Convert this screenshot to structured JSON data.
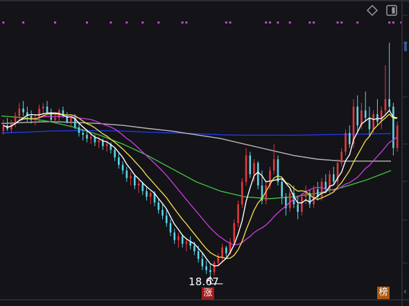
{
  "toolbar": {
    "diamond_icon": "diamond-outline-icon",
    "panel_icon": "panel-toggle-icon"
  },
  "annotations": {
    "low_price_label": "18.67",
    "zhang_badge": "涨",
    "bang_badge": "榜"
  },
  "colors": {
    "background": "#131318",
    "up": "#e8373d",
    "down": "#5fd3e6",
    "ma5": "#ffffff",
    "ma10": "#f0d84a",
    "ma20": "#c63bd8",
    "ma60": "#3fbf3f",
    "ma120": "#b9b9b9",
    "ma250": "#2238e6",
    "signal_dots": "#c24ad1"
  },
  "chart_data": {
    "type": "candlestick",
    "title": "",
    "ylim": [
      18.3,
      25.3
    ],
    "signal_dot_indices": [
      0,
      5,
      13,
      21,
      27,
      31,
      35,
      39,
      45,
      46,
      56,
      57,
      66,
      67,
      69,
      72,
      77,
      78,
      84,
      85,
      89,
      97,
      98,
      100
    ],
    "candles": [
      [
        22.55,
        22.85,
        22.45,
        22.7
      ],
      [
        22.7,
        22.9,
        22.55,
        22.6
      ],
      [
        22.6,
        22.85,
        22.5,
        22.75
      ],
      [
        22.75,
        23.05,
        22.65,
        22.95
      ],
      [
        22.95,
        23.3,
        22.85,
        23.15
      ],
      [
        23.15,
        23.35,
        22.95,
        23.05
      ],
      [
        23.05,
        23.2,
        22.8,
        22.95
      ],
      [
        22.95,
        23.1,
        22.75,
        22.85
      ],
      [
        22.85,
        23.0,
        22.7,
        22.9
      ],
      [
        22.9,
        23.25,
        22.8,
        23.15
      ],
      [
        23.15,
        23.3,
        23.0,
        23.2
      ],
      [
        23.2,
        23.35,
        23.0,
        23.05
      ],
      [
        23.05,
        23.15,
        22.8,
        22.85
      ],
      [
        22.85,
        23.0,
        22.75,
        22.9
      ],
      [
        22.9,
        23.15,
        22.8,
        23.1
      ],
      [
        23.1,
        23.2,
        22.9,
        22.95
      ],
      [
        22.95,
        23.05,
        22.75,
        22.8
      ],
      [
        22.8,
        22.95,
        22.65,
        22.9
      ],
      [
        22.9,
        23.0,
        22.6,
        22.65
      ],
      [
        22.65,
        22.75,
        22.4,
        22.5
      ],
      [
        22.5,
        22.6,
        22.3,
        22.45
      ],
      [
        22.45,
        22.55,
        22.25,
        22.35
      ],
      [
        22.35,
        22.5,
        22.2,
        22.4
      ],
      [
        22.4,
        22.45,
        22.15,
        22.25
      ],
      [
        22.25,
        22.4,
        22.1,
        22.3
      ],
      [
        22.3,
        22.35,
        22.05,
        22.15
      ],
      [
        22.15,
        22.3,
        22.0,
        22.2
      ],
      [
        22.2,
        22.25,
        21.95,
        22.05
      ],
      [
        22.05,
        22.1,
        21.75,
        21.85
      ],
      [
        21.85,
        21.95,
        21.55,
        21.65
      ],
      [
        21.65,
        21.75,
        21.4,
        21.5
      ],
      [
        21.5,
        21.6,
        21.2,
        21.3
      ],
      [
        21.3,
        21.45,
        21.1,
        21.35
      ],
      [
        21.35,
        21.4,
        21.0,
        21.1
      ],
      [
        21.1,
        21.25,
        20.9,
        21.15
      ],
      [
        21.15,
        21.2,
        20.85,
        20.95
      ],
      [
        20.95,
        21.05,
        20.7,
        20.8
      ],
      [
        20.8,
        20.95,
        20.6,
        20.9
      ],
      [
        20.9,
        20.95,
        20.55,
        20.65
      ],
      [
        20.65,
        20.75,
        20.35,
        20.45
      ],
      [
        20.45,
        20.6,
        20.2,
        20.3
      ],
      [
        20.3,
        20.45,
        20.0,
        20.1
      ],
      [
        20.1,
        20.2,
        19.75,
        19.85
      ],
      [
        19.85,
        19.95,
        19.55,
        19.65
      ],
      [
        19.65,
        19.85,
        19.45,
        19.75
      ],
      [
        19.75,
        19.8,
        19.45,
        19.55
      ],
      [
        19.55,
        19.7,
        19.35,
        19.6
      ],
      [
        19.6,
        19.75,
        19.4,
        19.5
      ],
      [
        19.5,
        19.6,
        19.25,
        19.35
      ],
      [
        19.35,
        19.5,
        19.05,
        19.15
      ],
      [
        19.15,
        19.3,
        18.85,
        18.95
      ],
      [
        18.95,
        19.1,
        18.75,
        18.85
      ],
      [
        18.85,
        19.0,
        18.67,
        18.8
      ],
      [
        18.8,
        19.1,
        18.7,
        19.05
      ],
      [
        19.05,
        19.3,
        18.95,
        19.2
      ],
      [
        19.2,
        19.55,
        19.1,
        19.45
      ],
      [
        19.45,
        19.5,
        19.2,
        19.3
      ],
      [
        19.3,
        19.7,
        19.25,
        19.6
      ],
      [
        19.6,
        20.2,
        19.5,
        20.1
      ],
      [
        20.1,
        20.7,
        20.0,
        20.6
      ],
      [
        20.6,
        21.3,
        20.5,
        21.2
      ],
      [
        21.2,
        22.1,
        21.1,
        21.9
      ],
      [
        21.9,
        22.0,
        21.3,
        21.4
      ],
      [
        21.4,
        21.8,
        21.2,
        21.7
      ],
      [
        21.7,
        21.75,
        21.0,
        21.1
      ],
      [
        21.1,
        21.5,
        20.6,
        20.7
      ],
      [
        20.7,
        21.2,
        20.6,
        21.1
      ],
      [
        21.1,
        21.6,
        21.0,
        21.5
      ],
      [
        21.5,
        22.2,
        21.4,
        21.8
      ],
      [
        21.8,
        21.9,
        21.1,
        21.2
      ],
      [
        21.2,
        21.3,
        20.6,
        20.8
      ],
      [
        20.8,
        20.9,
        20.3,
        20.5
      ],
      [
        20.5,
        21.0,
        20.4,
        20.9
      ],
      [
        20.9,
        21.1,
        20.5,
        20.6
      ],
      [
        20.6,
        20.8,
        20.2,
        20.4
      ],
      [
        20.4,
        20.9,
        20.3,
        20.8
      ],
      [
        20.8,
        21.1,
        20.6,
        20.9
      ],
      [
        20.9,
        21.0,
        20.5,
        20.6
      ],
      [
        20.6,
        21.1,
        20.5,
        21.0
      ],
      [
        21.0,
        21.2,
        20.7,
        20.8
      ],
      [
        20.8,
        21.3,
        20.7,
        21.2
      ],
      [
        21.2,
        21.4,
        20.9,
        21.0
      ],
      [
        21.0,
        21.5,
        20.9,
        21.4
      ],
      [
        21.4,
        21.6,
        21.1,
        21.2
      ],
      [
        21.2,
        21.8,
        21.1,
        21.7
      ],
      [
        21.7,
        22.1,
        21.6,
        22.0
      ],
      [
        22.0,
        22.6,
        21.9,
        22.5
      ],
      [
        22.5,
        22.7,
        22.1,
        22.2
      ],
      [
        22.2,
        23.4,
        22.1,
        23.2
      ],
      [
        23.2,
        23.5,
        22.5,
        22.7
      ],
      [
        22.7,
        23.3,
        22.6,
        23.1
      ],
      [
        23.1,
        23.6,
        22.8,
        22.9
      ],
      [
        22.9,
        23.2,
        22.4,
        22.6
      ],
      [
        22.6,
        23.1,
        22.5,
        23.0
      ],
      [
        23.0,
        23.4,
        22.7,
        22.8
      ],
      [
        22.8,
        23.2,
        22.6,
        23.1
      ],
      [
        23.1,
        24.3,
        23.0,
        23.4
      ],
      [
        23.4,
        24.9,
        23.1,
        23.2
      ],
      [
        23.2,
        23.3,
        21.9,
        22.1
      ],
      [
        22.1,
        22.8,
        22.0,
        22.7
      ]
    ],
    "moving_averages": [
      {
        "period": 5,
        "color_key": "ma5"
      },
      {
        "period": 10,
        "color_key": "ma10"
      },
      {
        "period": 20,
        "color_key": "ma20"
      },
      {
        "period": 60,
        "color_key": "ma60"
      },
      {
        "period": 120,
        "color_key": "ma120"
      },
      {
        "period": 250,
        "color_key": "ma250"
      }
    ],
    "long_ma_levels": {
      "ma60": [
        22.95,
        22.9,
        22.8,
        22.65,
        22.45,
        22.2,
        21.9,
        21.55,
        21.2,
        20.95,
        20.8,
        20.75,
        20.8,
        20.9,
        21.05,
        21.25,
        21.5
      ],
      "ma120": [
        22.75,
        22.78,
        22.8,
        22.78,
        22.75,
        22.7,
        22.62,
        22.55,
        22.45,
        22.35,
        22.2,
        22.05,
        21.9,
        21.8,
        21.75,
        21.75,
        21.75
      ],
      "ma250": [
        22.5,
        22.52,
        22.55,
        22.56,
        22.56,
        22.55,
        22.52,
        22.5,
        22.48,
        22.45,
        22.44,
        22.44,
        22.44,
        22.45,
        22.46,
        22.47,
        22.48
      ]
    }
  }
}
